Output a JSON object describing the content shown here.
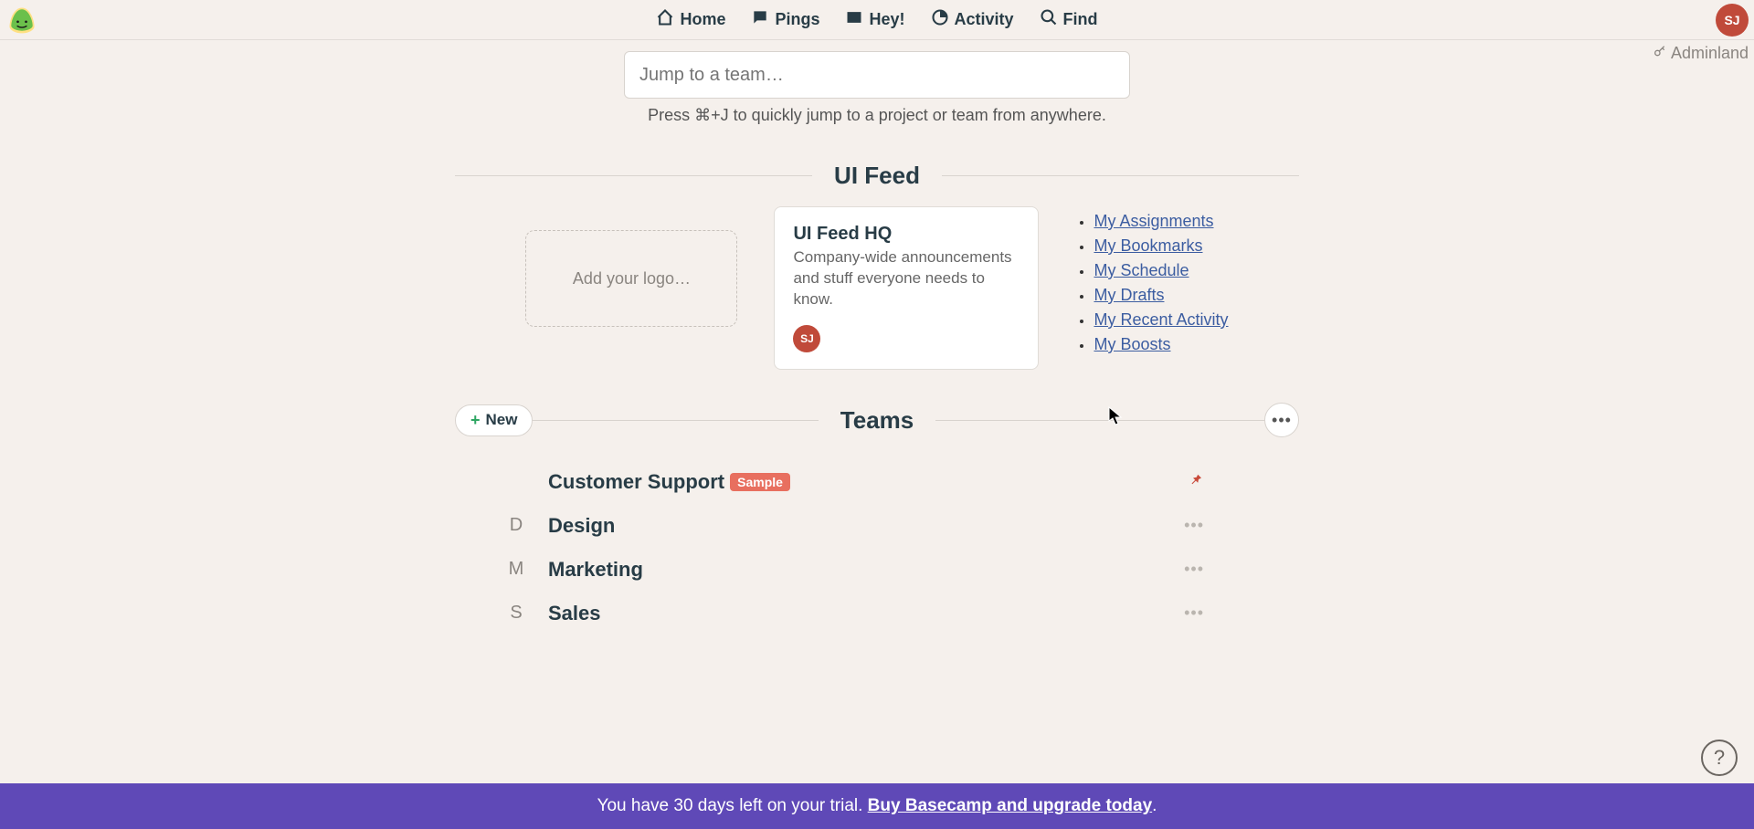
{
  "nav": {
    "home": "Home",
    "pings": "Pings",
    "hey": "Hey!",
    "activity": "Activity",
    "find": "Find"
  },
  "user": {
    "initials": "SJ"
  },
  "adminland": "Adminland",
  "jump": {
    "placeholder": "Jump to a team…",
    "hint": "Press ⌘+J to quickly jump to a project or team from anywhere."
  },
  "feed": {
    "section_label": "UI Feed",
    "logo_hint": "Add your logo…",
    "hq_title": "UI Feed HQ",
    "hq_desc": "Company-wide announcements and stuff everyone needs to know.",
    "hq_initials": "SJ"
  },
  "my_links": [
    "My Assignments",
    "My Bookmarks",
    "My Schedule",
    "My Drafts",
    "My Recent Activity",
    "My Boosts"
  ],
  "teams_section": {
    "label": "Teams",
    "new": "New"
  },
  "teams": [
    {
      "letter": "",
      "name": "Customer Support",
      "sample": "Sample",
      "pinned": true
    },
    {
      "letter": "D",
      "name": "Design"
    },
    {
      "letter": "M",
      "name": "Marketing"
    },
    {
      "letter": "S",
      "name": "Sales"
    }
  ],
  "trial": {
    "text_prefix": "You have 30 days left on your trial. ",
    "link": "Buy Basecamp and upgrade today",
    "suffix": "."
  },
  "help": "?"
}
